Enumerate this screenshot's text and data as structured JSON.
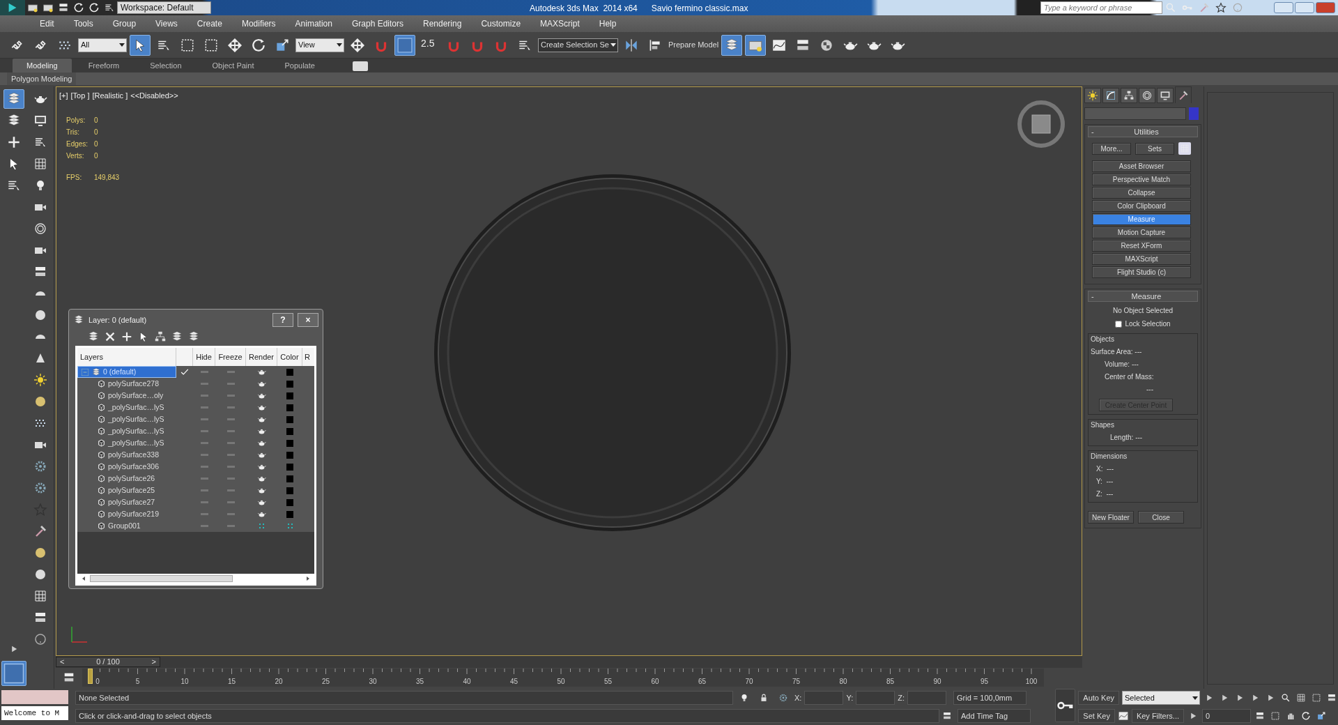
{
  "title_bar": {
    "workspace": "Workspace: Default",
    "title": "Autodesk 3ds Max  2014 x64",
    "file": "Savio fermino classic.max",
    "search_placeholder": "Type a keyword or phrase"
  },
  "menu": [
    "Edit",
    "Tools",
    "Group",
    "Views",
    "Create",
    "Modifiers",
    "Animation",
    "Graph Editors",
    "Rendering",
    "Customize",
    "MAXScript",
    "Help"
  ],
  "main_toolbar": [
    {
      "kind": "icon",
      "on": false
    },
    {
      "kind": "icon",
      "on": false
    },
    {
      "kind": "icon",
      "on": false
    },
    {
      "kind": "dropdown",
      "value": "All"
    },
    {
      "kind": "icon",
      "on": true
    },
    {
      "kind": "icon",
      "on": false
    },
    {
      "kind": "icon",
      "on": false
    },
    {
      "kind": "icon",
      "on": false
    },
    {
      "kind": "icon",
      "on": false
    },
    {
      "kind": "icon",
      "on": false
    },
    {
      "kind": "icon",
      "on": false
    },
    {
      "kind": "dropdown",
      "value": "View"
    },
    {
      "kind": "icon",
      "on": false
    },
    {
      "kind": "icon",
      "on": false
    },
    {
      "kind": "icon",
      "on": true
    },
    {
      "kind": "snap",
      "text": "2.5"
    },
    {
      "kind": "icon",
      "on": false
    },
    {
      "kind": "icon",
      "on": false
    },
    {
      "kind": "icon",
      "on": false
    },
    {
      "kind": "icon",
      "on": false
    },
    {
      "kind": "dropdown",
      "value": "Create Selection Se"
    },
    {
      "kind": "icon",
      "on": false
    },
    {
      "kind": "icon",
      "on": false
    },
    {
      "kind": "label",
      "text": "Prepare Model"
    },
    {
      "kind": "icon",
      "on": true
    },
    {
      "kind": "icon",
      "on": true
    },
    {
      "kind": "icon",
      "on": false
    },
    {
      "kind": "icon",
      "on": false
    },
    {
      "kind": "icon",
      "on": false
    },
    {
      "kind": "icon",
      "on": false
    },
    {
      "kind": "icon",
      "on": false
    },
    {
      "kind": "icon",
      "on": false
    }
  ],
  "ribbon": {
    "tabs": [
      {
        "label": "Modeling",
        "selected": true
      },
      {
        "label": "Freeform",
        "selected": false
      },
      {
        "label": "Selection",
        "selected": false
      },
      {
        "label": "Object Paint",
        "selected": false
      },
      {
        "label": "Populate",
        "selected": false
      }
    ],
    "panel": "Polygon Modeling"
  },
  "left_toolbar": {
    "column_1": [
      {
        "on": true
      },
      {
        "on": false
      },
      {
        "on": false
      },
      {
        "on": false
      },
      {
        "on": false
      }
    ],
    "bottom": [
      {
        "on": false
      },
      {
        "on": true
      }
    ]
  },
  "viewport": {
    "labels": [
      "[+]",
      "[Top ]",
      "[Realistic ]",
      "<<Disabled>>"
    ],
    "stats": [
      {
        "label": "Polys:",
        "value": "0"
      },
      {
        "label": "Tris:",
        "value": "0"
      },
      {
        "label": "Edges:",
        "value": "0"
      },
      {
        "label": "Verts:",
        "value": "0"
      }
    ],
    "fps": {
      "label": "FPS:",
      "value": "149,843"
    }
  },
  "layer_dialog": {
    "title": "Layer: 0 (default)",
    "help": "?",
    "close": "×",
    "columns": [
      "Layers",
      "Hide",
      "Freeze",
      "Render",
      "Color",
      "R"
    ],
    "rows": [
      {
        "name": "0 (default)",
        "selected": true,
        "current": true,
        "render": true,
        "color": "#000000",
        "children": [
          {
            "name": "polySurface278",
            "selected": false,
            "current": false,
            "render": true,
            "color": "#000000"
          },
          {
            "name": "polySurface…oly",
            "selected": false,
            "current": false,
            "render": true,
            "color": "#000000"
          },
          {
            "name": "_polySurfac…lyS",
            "selected": false,
            "current": false,
            "render": true,
            "color": "#000000"
          },
          {
            "name": "_polySurfac…lyS",
            "selected": false,
            "current": false,
            "render": true,
            "color": "#000000"
          },
          {
            "name": "_polySurfac…lyS",
            "selected": false,
            "current": false,
            "render": true,
            "color": "#000000"
          },
          {
            "name": "_polySurfac…lyS",
            "selected": false,
            "current": false,
            "render": true,
            "color": "#000000"
          },
          {
            "name": "polySurface338",
            "selected": false,
            "current": false,
            "render": true,
            "color": "#000000"
          },
          {
            "name": "polySurface306",
            "selected": false,
            "current": false,
            "render": true,
            "color": "#000000"
          },
          {
            "name": "polySurface26",
            "selected": false,
            "current": false,
            "render": true,
            "color": "#000000"
          },
          {
            "name": "polySurface25",
            "selected": false,
            "current": false,
            "render": true,
            "color": "#000000"
          },
          {
            "name": "polySurface27",
            "selected": false,
            "current": false,
            "render": true,
            "color": "#000000"
          },
          {
            "name": "polySurface219",
            "selected": false,
            "current": false,
            "render": true,
            "color": "#000000"
          },
          {
            "name": "Group001",
            "selected": false,
            "current": false,
            "render": false,
            "mixed": true
          }
        ]
      }
    ]
  },
  "command_panel": {
    "tabs": [
      {
        "selected": false
      },
      {
        "selected": false
      },
      {
        "selected": false
      },
      {
        "selected": false
      },
      {
        "selected": false
      },
      {
        "selected": true
      }
    ],
    "utilities": {
      "toggle": "-",
      "title": "Utilities",
      "more": "More...",
      "sets": "Sets",
      "buttons": [
        {
          "label": "Asset Browser",
          "selected": false
        },
        {
          "label": "Perspective Match",
          "selected": false
        },
        {
          "label": "Collapse",
          "selected": false
        },
        {
          "label": "Color Clipboard",
          "selected": false
        },
        {
          "label": "Measure",
          "selected": true
        },
        {
          "label": "Motion Capture",
          "selected": false
        },
        {
          "label": "Reset XForm",
          "selected": false
        },
        {
          "label": "MAXScript",
          "selected": false
        },
        {
          "label": "Flight Studio (c)",
          "selected": false
        }
      ]
    },
    "measure": {
      "toggle": "-",
      "title": "Measure",
      "status": "No Object Selected",
      "lock": {
        "label": "Lock Selection",
        "checked": false
      },
      "groups": [
        {
          "title": "Objects",
          "lines": [
            "Surface Area: ---",
            "Volume: ---",
            "Center of Mass:",
            "---"
          ],
          "button": {
            "label": "Create Center Point",
            "disabled": true
          }
        },
        {
          "title": "Shapes",
          "lines": [
            "Length: ---"
          ]
        },
        {
          "title": "Dimensions",
          "lines": [
            "X:  ---",
            "Y:  ---",
            "Z:  ---"
          ]
        }
      ],
      "buttons": [
        "New Floater",
        "Close"
      ]
    }
  },
  "time_slider": {
    "label": "0 / 100",
    "prev": "<",
    "next": ">",
    "level": 0
  },
  "trackbar": {
    "labels": [
      "0",
      "5",
      "10",
      "15",
      "20",
      "25",
      "30",
      "35",
      "40",
      "45",
      "50",
      "55",
      "60",
      "65",
      "70",
      "75",
      "80",
      "85",
      "90",
      "95",
      "100"
    ]
  },
  "status": {
    "listener_output": "Welcome to M",
    "selection": "None Selected",
    "prompt": "Click or click-and-drag to select objects",
    "x_label": "X:",
    "y_label": "Y:",
    "z_label": "Z:",
    "grid": "Grid = 100,0mm",
    "time_tag": "Add Time Tag"
  },
  "animation": {
    "auto_key": "Auto Key",
    "set_key": "Set Key",
    "key_set": "Selected",
    "key_filters": "Key Filters...",
    "frame": "0"
  }
}
